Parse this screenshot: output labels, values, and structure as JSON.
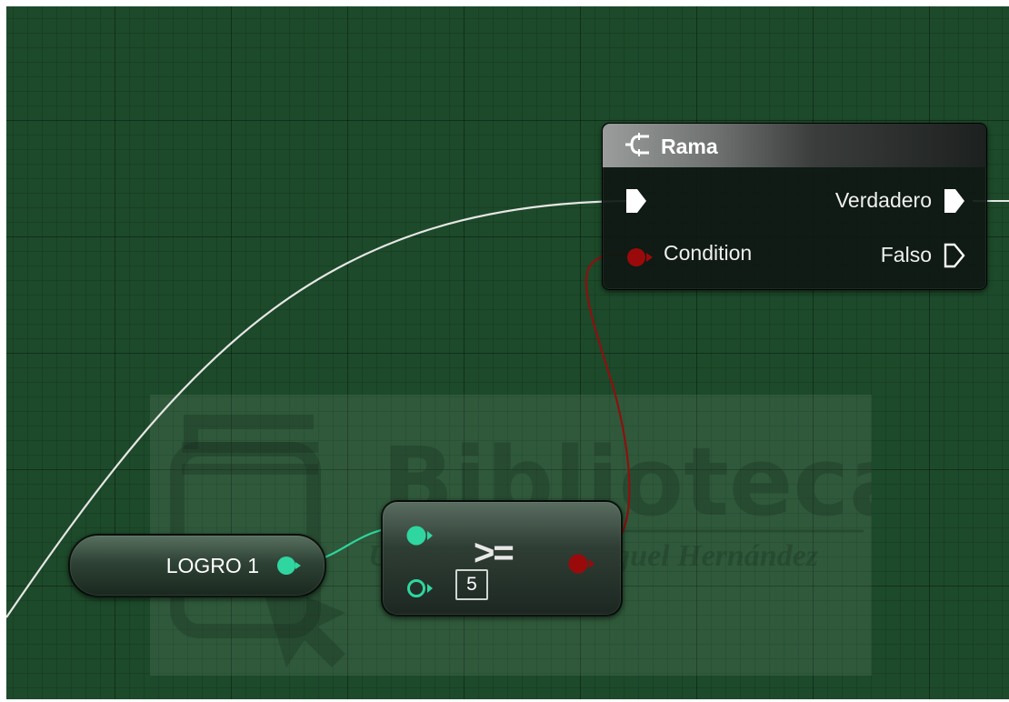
{
  "colors": {
    "graph_background": "#1d4a2a",
    "exec_wire": "#e6e6e6",
    "boolean_pin": "#9b0a0a",
    "integer_pin": "#2fd6a0"
  },
  "watermark": {
    "title": "Biblioteca",
    "subtitle": "UNIVERSITAS Miguel Hernández"
  },
  "branch_node": {
    "title": "Rama",
    "icon": "branch-icon",
    "inputs": {
      "condition_label": "Condition"
    },
    "outputs": {
      "true_label": "Verdadero",
      "false_label": "Falso"
    }
  },
  "variable_node": {
    "label": "LOGRO 1"
  },
  "compare_node": {
    "operator": ">=",
    "b_default": "5"
  }
}
